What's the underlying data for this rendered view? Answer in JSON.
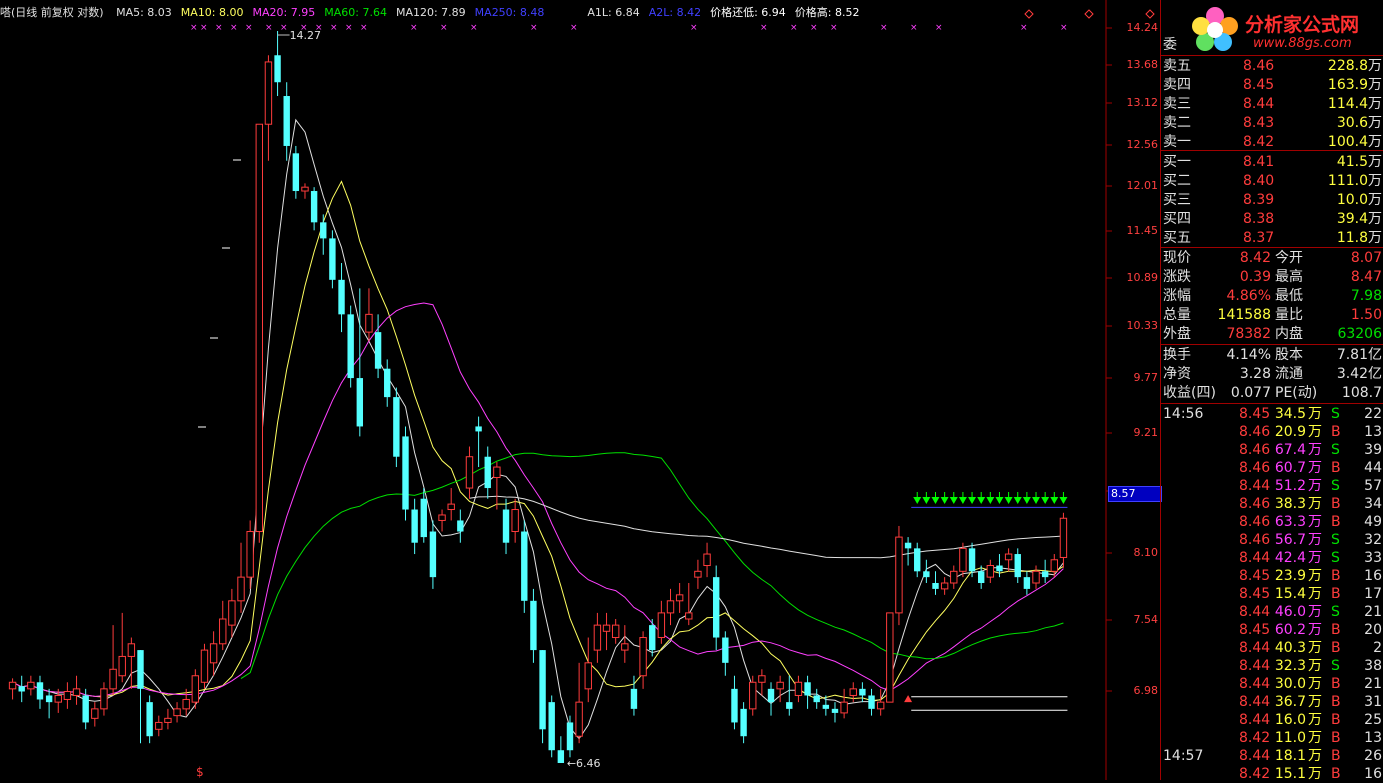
{
  "legend": {
    "title": "嗒(日线 前复权 对数)",
    "items": [
      {
        "text": "MA5: 8.03",
        "color": "#e0e0e0"
      },
      {
        "text": "MA10: 8.00",
        "color": "#ffff60"
      },
      {
        "text": "MA20: 7.95",
        "color": "#ff40ff"
      },
      {
        "text": "MA60: 7.64",
        "color": "#00e000"
      },
      {
        "text": "MA120: 7.89",
        "color": "#e0e0e0"
      },
      {
        "text": "MA250: 8.48",
        "color": "#4040ff"
      },
      {
        "text": "A1L: 6.84",
        "color": "#e0e0e0"
      },
      {
        "text": "A2L: 8.42",
        "color": "#4040ff"
      },
      {
        "text": "价格还低: 6.94",
        "color": "#ffffff"
      },
      {
        "text": "价格高: 8.52",
        "color": "#ffffff"
      }
    ]
  },
  "y_axis_ticks": [
    "14.24",
    "13.68",
    "13.12",
    "12.56",
    "12.01",
    "11.45",
    "10.89",
    "10.33",
    "9.77",
    "9.21",
    "8.66",
    "8.10",
    "7.54",
    "6.98"
  ],
  "current_price_tag": "8.57",
  "annotations": {
    "high": "14.27",
    "low": "6.46",
    "signal": "$"
  },
  "chart_data": {
    "type": "candlestick",
    "title": "",
    "ylim": [
      6.46,
      14.27
    ],
    "log_scale": true,
    "candles": [
      [
        7.0,
        7.05,
        6.92,
        7.08
      ],
      [
        7.02,
        6.98,
        6.9,
        7.1
      ],
      [
        7.0,
        7.05,
        6.95,
        7.1
      ],
      [
        7.05,
        6.92,
        6.85,
        7.1
      ],
      [
        6.95,
        6.9,
        6.78,
        7.0
      ],
      [
        6.9,
        6.95,
        6.82,
        7.0
      ],
      [
        6.92,
        6.98,
        6.85,
        7.05
      ],
      [
        6.95,
        7.0,
        6.88,
        7.1
      ],
      [
        6.95,
        6.75,
        6.7,
        7.0
      ],
      [
        6.78,
        6.85,
        6.72,
        6.9
      ],
      [
        6.85,
        7.0,
        6.8,
        7.05
      ],
      [
        7.0,
        7.15,
        6.95,
        7.5
      ],
      [
        7.1,
        7.25,
        7.05,
        7.6
      ],
      [
        7.25,
        7.35,
        7.0,
        7.4
      ],
      [
        7.3,
        7.0,
        6.6,
        7.3
      ],
      [
        6.9,
        6.65,
        6.6,
        6.95
      ],
      [
        6.7,
        6.75,
        6.65,
        6.8
      ],
      [
        6.75,
        6.78,
        6.7,
        6.85
      ],
      [
        6.8,
        6.85,
        6.75,
        6.9
      ],
      [
        6.85,
        6.92,
        6.8,
        7.0
      ],
      [
        6.9,
        7.1,
        6.85,
        7.15
      ],
      [
        7.05,
        7.3,
        7.0,
        7.35
      ],
      [
        7.2,
        7.35,
        7.1,
        7.45
      ],
      [
        7.35,
        7.55,
        7.3,
        7.7
      ],
      [
        7.5,
        7.7,
        7.4,
        7.8
      ],
      [
        7.7,
        7.9,
        7.6,
        8.2
      ],
      [
        7.9,
        8.3,
        7.8,
        8.4
      ],
      [
        8.3,
        12.9,
        8.2,
        12.9
      ],
      [
        12.9,
        13.8,
        12.4,
        13.9
      ],
      [
        13.9,
        13.5,
        13.3,
        14.27
      ],
      [
        13.3,
        12.6,
        12.4,
        13.5
      ],
      [
        12.5,
        12.0,
        11.9,
        12.6
      ],
      [
        12.0,
        12.05,
        11.9,
        12.1
      ],
      [
        12.0,
        11.6,
        11.5,
        12.05
      ],
      [
        11.6,
        11.4,
        11.2,
        11.7
      ],
      [
        11.4,
        10.9,
        10.8,
        11.5
      ],
      [
        10.9,
        10.5,
        10.3,
        11.1
      ],
      [
        10.5,
        9.8,
        9.7,
        10.6
      ],
      [
        9.8,
        9.3,
        9.2,
        10.8
      ],
      [
        10.3,
        10.5,
        10.2,
        10.8
      ],
      [
        10.3,
        9.9,
        9.8,
        10.5
      ],
      [
        9.9,
        9.6,
        9.5,
        10.0
      ],
      [
        9.6,
        9.0,
        8.9,
        9.7
      ],
      [
        9.2,
        8.5,
        8.4,
        9.3
      ],
      [
        8.5,
        8.2,
        8.1,
        8.6
      ],
      [
        8.6,
        8.25,
        8.2,
        8.7
      ],
      [
        8.3,
        7.9,
        7.8,
        8.4
      ],
      [
        8.4,
        8.45,
        8.3,
        8.5
      ],
      [
        8.5,
        8.55,
        8.4,
        8.7
      ],
      [
        8.4,
        8.3,
        8.2,
        8.5
      ],
      [
        8.7,
        9.0,
        8.6,
        9.1
      ],
      [
        9.3,
        9.25,
        8.9,
        9.4
      ],
      [
        9.0,
        8.7,
        8.6,
        9.1
      ],
      [
        8.8,
        8.9,
        8.5,
        8.95
      ],
      [
        8.5,
        8.2,
        8.1,
        8.6
      ],
      [
        8.3,
        8.5,
        8.2,
        8.6
      ],
      [
        8.3,
        7.7,
        7.6,
        8.4
      ],
      [
        7.7,
        7.3,
        7.2,
        7.8
      ],
      [
        7.3,
        6.7,
        6.6,
        7.3
      ],
      [
        6.9,
        6.55,
        6.5,
        6.95
      ],
      [
        6.55,
        6.46,
        6.46,
        6.65
      ],
      [
        6.75,
        6.55,
        6.5,
        6.8
      ],
      [
        6.65,
        6.9,
        6.6,
        7.2
      ],
      [
        7.0,
        7.2,
        6.9,
        7.4
      ],
      [
        7.3,
        7.5,
        7.2,
        7.6
      ],
      [
        7.45,
        7.5,
        7.3,
        7.6
      ],
      [
        7.4,
        7.5,
        7.35,
        7.55
      ],
      [
        7.3,
        7.35,
        7.2,
        7.5
      ],
      [
        7.0,
        6.85,
        6.8,
        7.1
      ],
      [
        7.1,
        7.4,
        7.0,
        7.45
      ],
      [
        7.5,
        7.3,
        7.25,
        7.55
      ],
      [
        7.4,
        7.6,
        7.35,
        7.7
      ],
      [
        7.6,
        7.7,
        7.5,
        7.8
      ],
      [
        7.7,
        7.75,
        7.6,
        7.85
      ],
      [
        7.55,
        7.6,
        7.5,
        7.85
      ],
      [
        7.9,
        7.95,
        7.8,
        8.05
      ],
      [
        8.0,
        8.1,
        7.9,
        8.2
      ],
      [
        7.9,
        7.4,
        7.3,
        8.0
      ],
      [
        7.4,
        7.2,
        7.1,
        7.45
      ],
      [
        7.0,
        6.75,
        6.7,
        7.1
      ],
      [
        6.85,
        6.65,
        6.6,
        6.9
      ],
      [
        6.85,
        7.05,
        6.8,
        7.1
      ],
      [
        7.05,
        7.1,
        6.95,
        7.15
      ],
      [
        7.0,
        6.9,
        6.8,
        7.05
      ],
      [
        7.0,
        7.05,
        6.9,
        7.1
      ],
      [
        6.9,
        6.85,
        6.8,
        7.1
      ],
      [
        6.95,
        7.05,
        6.9,
        7.1
      ],
      [
        7.05,
        6.95,
        6.85,
        7.1
      ],
      [
        6.95,
        6.9,
        6.85,
        7.0
      ],
      [
        6.88,
        6.85,
        6.8,
        6.95
      ],
      [
        6.85,
        6.82,
        6.75,
        6.9
      ],
      [
        6.82,
        6.9,
        6.78,
        7.0
      ],
      [
        6.95,
        7.0,
        6.9,
        7.05
      ],
      [
        7.0,
        6.95,
        6.9,
        7.05
      ],
      [
        6.95,
        6.85,
        6.8,
        7.0
      ],
      [
        6.85,
        6.9,
        6.8,
        7.0
      ],
      [
        6.9,
        7.6,
        6.9,
        7.6
      ],
      [
        7.6,
        8.25,
        7.5,
        8.35
      ],
      [
        8.2,
        8.15,
        8.0,
        8.25
      ],
      [
        8.15,
        7.95,
        7.9,
        8.2
      ],
      [
        7.95,
        7.9,
        7.85,
        8.05
      ],
      [
        7.85,
        7.8,
        7.75,
        7.95
      ],
      [
        7.8,
        7.85,
        7.75,
        7.9
      ],
      [
        7.85,
        7.95,
        7.8,
        8.0
      ],
      [
        7.95,
        8.15,
        7.9,
        8.2
      ],
      [
        8.15,
        7.95,
        7.9,
        8.2
      ],
      [
        7.95,
        7.85,
        7.8,
        8.0
      ],
      [
        7.9,
        8.0,
        7.85,
        8.05
      ],
      [
        8.0,
        7.95,
        7.9,
        8.1
      ],
      [
        8.05,
        8.1,
        7.95,
        8.15
      ],
      [
        8.1,
        7.9,
        7.85,
        8.15
      ],
      [
        7.9,
        7.8,
        7.75,
        7.95
      ],
      [
        7.85,
        7.95,
        7.8,
        8.0
      ],
      [
        7.95,
        7.9,
        7.85,
        8.05
      ],
      [
        7.95,
        8.05,
        7.9,
        8.1
      ],
      [
        8.07,
        8.42,
        7.98,
        8.47
      ]
    ],
    "ma_lines": [
      {
        "name": "MA5",
        "color": "#e0e0e0"
      },
      {
        "name": "MA10",
        "color": "#ffff60"
      },
      {
        "name": "MA20",
        "color": "#ff40ff"
      },
      {
        "name": "MA60",
        "color": "#00e000"
      },
      {
        "name": "MA120",
        "color": "#e0e0e0"
      }
    ],
    "reference_lines": [
      {
        "value": 8.52,
        "color": "#4040ff"
      },
      {
        "value": 6.94,
        "color": "#ffffff"
      },
      {
        "value": 6.84,
        "color": "#ffffff"
      }
    ]
  },
  "panel": {
    "logo_title": "分析家公式网",
    "logo_url": "www.88gs.com",
    "weibi_label": "委",
    "asks": [
      {
        "label": "卖五",
        "price": "8.46",
        "vol": "228.8",
        "unit": "万"
      },
      {
        "label": "卖四",
        "price": "8.45",
        "vol": "163.9",
        "unit": "万"
      },
      {
        "label": "卖三",
        "price": "8.44",
        "vol": "114.4",
        "unit": "万"
      },
      {
        "label": "卖二",
        "price": "8.43",
        "vol": "30.6",
        "unit": "万"
      },
      {
        "label": "卖一",
        "price": "8.42",
        "vol": "100.4",
        "unit": "万"
      }
    ],
    "bids": [
      {
        "label": "买一",
        "price": "8.41",
        "vol": "41.5",
        "unit": "万"
      },
      {
        "label": "买二",
        "price": "8.40",
        "vol": "111.0",
        "unit": "万"
      },
      {
        "label": "买三",
        "price": "8.39",
        "vol": "10.0",
        "unit": "万"
      },
      {
        "label": "买四",
        "price": "8.38",
        "vol": "39.4",
        "unit": "万"
      },
      {
        "label": "买五",
        "price": "8.37",
        "vol": "11.8",
        "unit": "万"
      }
    ],
    "quote": [
      {
        "l1": "现价",
        "v1": "8.42",
        "c1": "red",
        "l2": "今开",
        "v2": "8.07",
        "c2": "red"
      },
      {
        "l1": "涨跌",
        "v1": "0.39",
        "c1": "red",
        "l2": "最高",
        "v2": "8.47",
        "c2": "red"
      },
      {
        "l1": "涨幅",
        "v1": "4.86%",
        "c1": "red",
        "l2": "最低",
        "v2": "7.98",
        "c2": "grn"
      },
      {
        "l1": "总量",
        "v1": "141588",
        "c1": "yel",
        "l2": "量比",
        "v2": "1.50",
        "c2": "red"
      },
      {
        "l1": "外盘",
        "v1": "78382",
        "c1": "red",
        "l2": "内盘",
        "v2": "63206",
        "c2": "grn"
      }
    ],
    "fundamentals": [
      {
        "l1": "换手",
        "v1": "4.14%",
        "l2": "股本",
        "v2": "7.81亿"
      },
      {
        "l1": "净资",
        "v1": "3.28",
        "l2": "流通",
        "v2": "3.42亿"
      },
      {
        "l1": "收益(四)",
        "v1": "0.077",
        "l2": "PE(动)",
        "v2": "108.7"
      }
    ],
    "ticks_time1": "14:56",
    "ticks": [
      {
        "price": "8.45",
        "vol": "34.5",
        "vc": "yel",
        "side": "S",
        "n": "22"
      },
      {
        "price": "8.46",
        "vol": "20.9",
        "vc": "yel",
        "side": "B",
        "n": "13"
      },
      {
        "price": "8.46",
        "vol": "67.4",
        "vc": "mag",
        "side": "S",
        "n": "39"
      },
      {
        "price": "8.46",
        "vol": "60.7",
        "vc": "mag",
        "side": "B",
        "n": "44"
      },
      {
        "price": "8.44",
        "vol": "51.2",
        "vc": "mag",
        "side": "S",
        "n": "57"
      },
      {
        "price": "8.46",
        "vol": "38.3",
        "vc": "yel",
        "side": "B",
        "n": "34"
      },
      {
        "price": "8.46",
        "vol": "63.3",
        "vc": "mag",
        "side": "B",
        "n": "49"
      },
      {
        "price": "8.46",
        "vol": "56.7",
        "vc": "mag",
        "side": "S",
        "n": "32"
      },
      {
        "price": "8.44",
        "vol": "42.4",
        "vc": "mag",
        "side": "S",
        "n": "33"
      },
      {
        "price": "8.45",
        "vol": "23.9",
        "vc": "yel",
        "side": "B",
        "n": "16"
      },
      {
        "price": "8.45",
        "vol": "15.4",
        "vc": "yel",
        "side": "B",
        "n": "17"
      },
      {
        "price": "8.44",
        "vol": "46.0",
        "vc": "mag",
        "side": "S",
        "n": "21"
      },
      {
        "price": "8.45",
        "vol": "60.2",
        "vc": "mag",
        "side": "B",
        "n": "20"
      },
      {
        "price": "8.44",
        "vol": "40.3",
        "vc": "yel",
        "side": "B",
        "n": "2"
      },
      {
        "price": "8.44",
        "vol": "32.3",
        "vc": "yel",
        "side": "S",
        "n": "38"
      },
      {
        "price": "8.44",
        "vol": "30.0",
        "vc": "yel",
        "side": "B",
        "n": "21"
      },
      {
        "price": "8.44",
        "vol": "36.7",
        "vc": "yel",
        "side": "B",
        "n": "31"
      },
      {
        "price": "8.44",
        "vol": "16.0",
        "vc": "yel",
        "side": "B",
        "n": "25"
      },
      {
        "price": "8.42",
        "vol": "11.0",
        "vc": "yel",
        "side": "B",
        "n": "13"
      }
    ],
    "ticks_time2": "14:57",
    "ticks2": [
      {
        "price": "8.44",
        "vol": "18.1",
        "vc": "yel",
        "side": "B",
        "n": "26"
      },
      {
        "price": "8.42",
        "vol": "15.1",
        "vc": "yel",
        "side": "B",
        "n": "16"
      }
    ],
    "unit_wan": "万"
  }
}
